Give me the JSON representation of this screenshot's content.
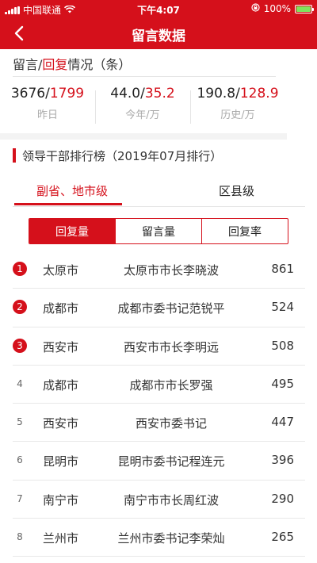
{
  "status_bar": {
    "carrier": "中国联通",
    "time": "下午4:07",
    "battery": "100%"
  },
  "nav": {
    "title": "留言数据"
  },
  "stats": {
    "title_prefix": "留言/",
    "title_red": "回复",
    "title_suffix": "情况（条）",
    "items": [
      {
        "black": "3676/",
        "red": "1799",
        "label": "昨日"
      },
      {
        "black": "44.0/",
        "red": "35.2",
        "label": "今年/万"
      },
      {
        "black": "190.8/",
        "red": "128.9",
        "label": "历史/万"
      }
    ]
  },
  "ranking": {
    "title": "领导干部排行榜（2019年07月排行）",
    "tabs": [
      "副省、地市级",
      "区县级"
    ],
    "segments": [
      "回复量",
      "留言量",
      "回复率"
    ],
    "rows": [
      {
        "rank": "1",
        "city": "太原市",
        "person": "太原市市长李晓波",
        "count": "861"
      },
      {
        "rank": "2",
        "city": "成都市",
        "person": "成都市委书记范锐平",
        "count": "524"
      },
      {
        "rank": "3",
        "city": "西安市",
        "person": "西安市市长李明远",
        "count": "508"
      },
      {
        "rank": "4",
        "city": "成都市",
        "person": "成都市市长罗强",
        "count": "495"
      },
      {
        "rank": "5",
        "city": "西安市",
        "person": "西安市委书记",
        "count": "447"
      },
      {
        "rank": "6",
        "city": "昆明市",
        "person": "昆明市委书记程连元",
        "count": "396"
      },
      {
        "rank": "7",
        "city": "南宁市",
        "person": "南宁市市长周红波",
        "count": "290"
      },
      {
        "rank": "8",
        "city": "兰州市",
        "person": "兰州市委书记李荣灿",
        "count": "265"
      }
    ]
  },
  "colors": {
    "accent": "#d5101b"
  }
}
